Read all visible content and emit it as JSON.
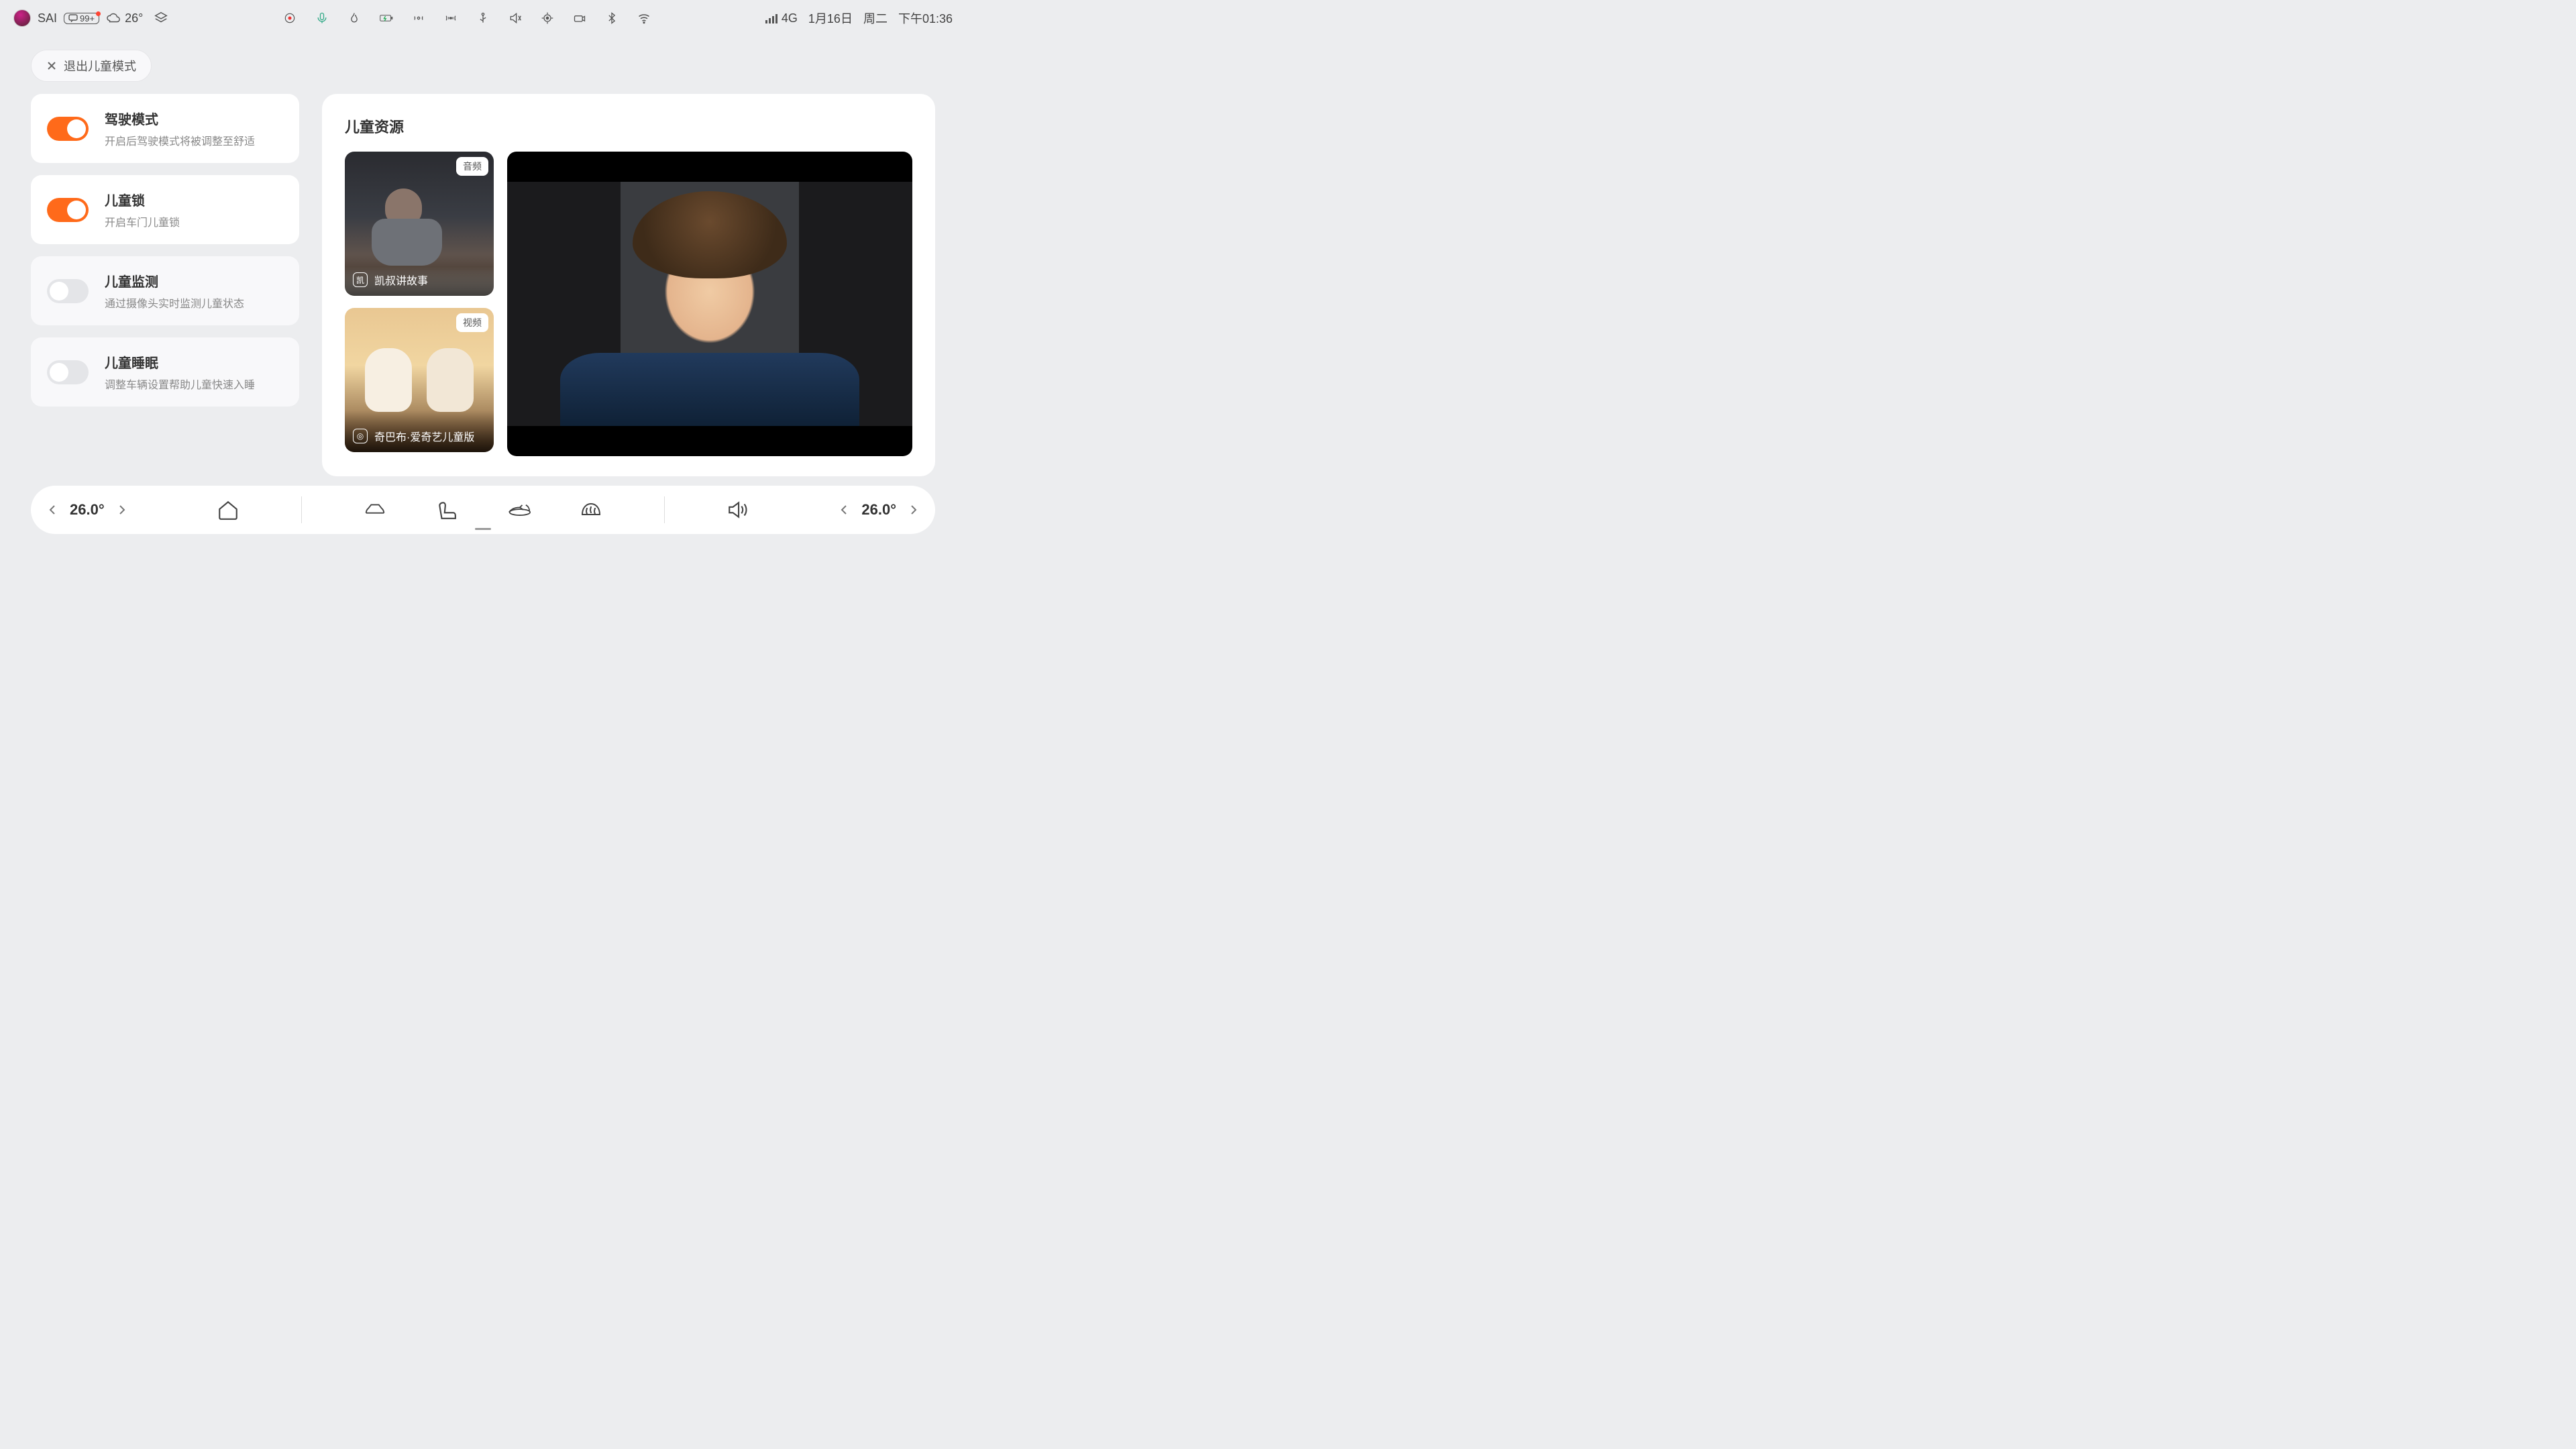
{
  "status_bar": {
    "user": "SAI",
    "msg_count": "99+",
    "temperature": "26°",
    "date": "1月16日",
    "weekday": "周二",
    "time": "下午01:36",
    "network": "4G"
  },
  "exit_button": {
    "label": "退出儿童模式"
  },
  "toggles": [
    {
      "title": "驾驶模式",
      "subtitle": "开启后驾驶模式将被调整至舒适",
      "on": true
    },
    {
      "title": "儿童锁",
      "subtitle": "开启车门儿童锁",
      "on": true
    },
    {
      "title": "儿童监测",
      "subtitle": "通过摄像头实时监测儿童状态",
      "on": false
    },
    {
      "title": "儿童睡眠",
      "subtitle": "调整车辆设置帮助儿童快速入睡",
      "on": false
    }
  ],
  "resource_panel": {
    "title": "儿童资源",
    "cards": [
      {
        "tag": "音频",
        "label": "凯叔讲故事",
        "chip": "凯"
      },
      {
        "tag": "视频",
        "label": "奇巴布·爱奇艺儿童版",
        "chip": "◎"
      }
    ]
  },
  "dock": {
    "left_temp": "26.0°",
    "right_temp": "26.0°"
  }
}
